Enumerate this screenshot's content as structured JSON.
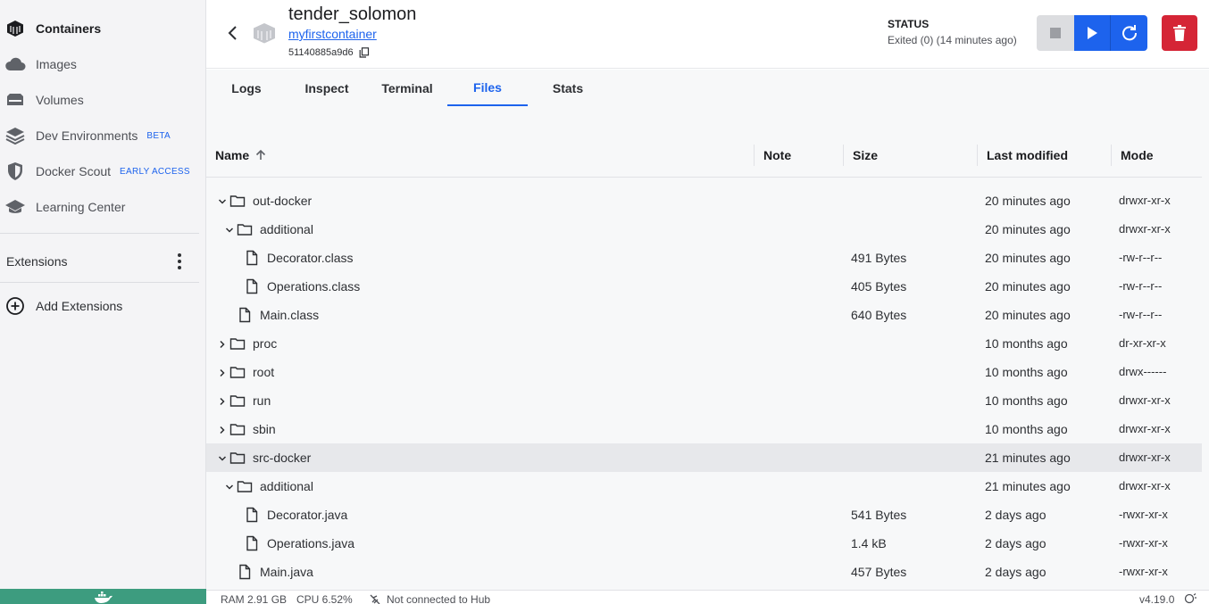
{
  "sidebar": {
    "items": [
      {
        "label": "Containers",
        "icon": "containers-icon",
        "active": true
      },
      {
        "label": "Images",
        "icon": "cloud-icon"
      },
      {
        "label": "Volumes",
        "icon": "volume-icon"
      },
      {
        "label": "Dev Environments",
        "icon": "dev-env-icon",
        "badge": "BETA"
      },
      {
        "label": "Docker Scout",
        "icon": "shield-icon",
        "badge": "EARLY ACCESS"
      },
      {
        "label": "Learning Center",
        "icon": "graduation-cap-icon"
      }
    ],
    "extensions_label": "Extensions",
    "add_extensions_label": "Add Extensions"
  },
  "header": {
    "container_name": "tender_solomon",
    "image_name": "myfirstcontainer",
    "container_id": "51140885a9d6",
    "status_label": "STATUS",
    "status_text": "Exited (0) (14 minutes ago)"
  },
  "tabs": [
    {
      "label": "Logs"
    },
    {
      "label": "Inspect"
    },
    {
      "label": "Terminal"
    },
    {
      "label": "Files",
      "active": true
    },
    {
      "label": "Stats"
    }
  ],
  "table": {
    "columns": {
      "name": "Name",
      "note": "Note",
      "size": "Size",
      "modified": "Last modified",
      "mode": "Mode"
    },
    "rows": [
      {
        "name": "out-docker",
        "type": "folder",
        "level": 0,
        "expanded": true,
        "size": "",
        "modified": "20 minutes ago",
        "mode": "drwxr-xr-x"
      },
      {
        "name": "additional",
        "type": "folder",
        "level": 1,
        "expanded": true,
        "size": "",
        "modified": "20 minutes ago",
        "mode": "drwxr-xr-x"
      },
      {
        "name": "Decorator.class",
        "type": "file",
        "level": 2,
        "size": "491 Bytes",
        "modified": "20 minutes ago",
        "mode": "-rw-r--r--"
      },
      {
        "name": "Operations.class",
        "type": "file",
        "level": 2,
        "size": "405 Bytes",
        "modified": "20 minutes ago",
        "mode": "-rw-r--r--"
      },
      {
        "name": "Main.class",
        "type": "file",
        "level": 1,
        "size": "640 Bytes",
        "modified": "20 minutes ago",
        "mode": "-rw-r--r--"
      },
      {
        "name": "proc",
        "type": "folder",
        "level": 0,
        "expanded": false,
        "size": "",
        "modified": "10 months ago",
        "mode": "dr-xr-xr-x"
      },
      {
        "name": "root",
        "type": "folder",
        "level": 0,
        "expanded": false,
        "size": "",
        "modified": "10 months ago",
        "mode": "drwx------"
      },
      {
        "name": "run",
        "type": "folder",
        "level": 0,
        "expanded": false,
        "size": "",
        "modified": "10 months ago",
        "mode": "drwxr-xr-x"
      },
      {
        "name": "sbin",
        "type": "folder",
        "level": 0,
        "expanded": false,
        "size": "",
        "modified": "10 months ago",
        "mode": "drwxr-xr-x"
      },
      {
        "name": "src-docker",
        "type": "folder",
        "level": 0,
        "expanded": true,
        "selected": true,
        "size": "",
        "modified": "21 minutes ago",
        "mode": "drwxr-xr-x"
      },
      {
        "name": "additional",
        "type": "folder",
        "level": 1,
        "expanded": true,
        "size": "",
        "modified": "21 minutes ago",
        "mode": "drwxr-xr-x"
      },
      {
        "name": "Decorator.java",
        "type": "file",
        "level": 2,
        "size": "541 Bytes",
        "modified": "2 days ago",
        "mode": "-rwxr-xr-x"
      },
      {
        "name": "Operations.java",
        "type": "file",
        "level": 2,
        "size": "1.4 kB",
        "modified": "2 days ago",
        "mode": "-rwxr-xr-x"
      },
      {
        "name": "Main.java",
        "type": "file",
        "level": 1,
        "size": "457 Bytes",
        "modified": "2 days ago",
        "mode": "-rwxr-xr-x"
      }
    ]
  },
  "statusbar": {
    "ram": "RAM 2.91 GB",
    "cpu": "CPU 6.52%",
    "hub": "Not connected to Hub",
    "version": "v4.19.0"
  },
  "colors": {
    "accent": "#1d63ed",
    "danger": "#d52536",
    "footer_green": "#3d9c7f"
  }
}
